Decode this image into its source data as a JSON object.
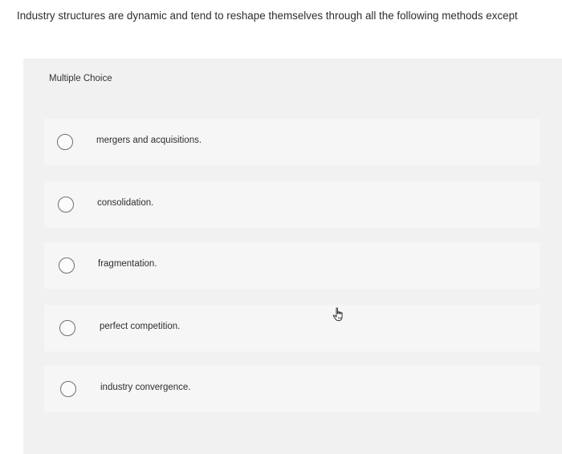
{
  "question": {
    "text": "Industry structures are dynamic and tend to reshape themselves through all the following methods except"
  },
  "panel": {
    "type_label": "Multiple Choice"
  },
  "options": [
    {
      "label": "mergers and acquisitions."
    },
    {
      "label": "consolidation."
    },
    {
      "label": "fragmentation."
    },
    {
      "label": "perfect competition."
    },
    {
      "label": "industry convergence."
    }
  ],
  "cursor": {
    "icon": "hand-pointer-icon"
  }
}
